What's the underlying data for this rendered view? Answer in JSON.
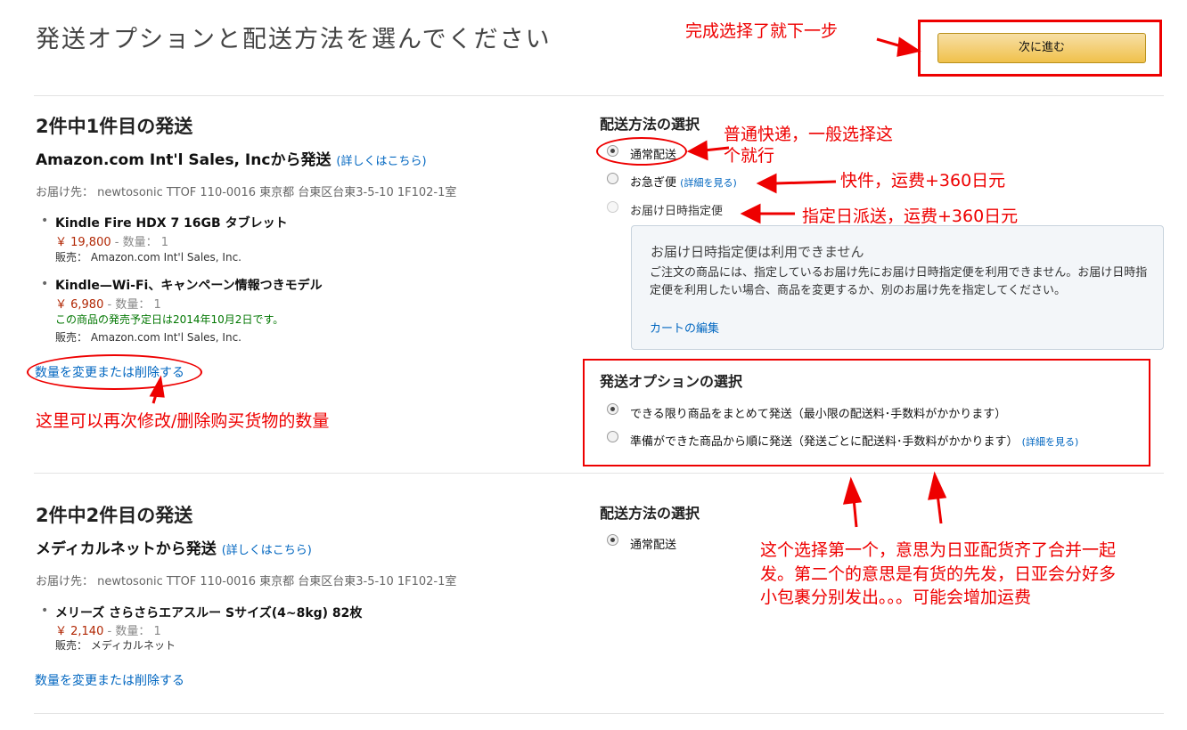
{
  "header": {
    "title": "発送オプションと配送方法を選んでください",
    "next_button": "次に進む"
  },
  "shipment1": {
    "title": "2件中1件目の発送",
    "seller": "Amazon.com Int'l Sales, Incから発送",
    "seller_link": "(詳しくはこちら)",
    "address": "お届け先： newtosonic TTOF 110-0016 東京都 台東区台東3-5-10 1F102-1室",
    "items": [
      {
        "name": "Kindle Fire HDX 7 16GB タブレット",
        "price": "￥ 19,800",
        "qty": "- 数量： 1",
        "release": "",
        "sold_by": "販売： Amazon.com Int'l Sales, Inc."
      },
      {
        "name": "Kindle—Wi-Fi、キャンペーン情報つきモデル",
        "price": "￥ 6,980",
        "qty": "- 数量： 1",
        "release": "この商品の発売予定日は2014年10月2日です。",
        "sold_by": "販売： Amazon.com Int'l Sales, Inc."
      }
    ],
    "change_link": "数量を変更または削除する",
    "delivery_head": "配送方法の選択",
    "delivery_options": [
      {
        "label": "通常配送",
        "link": "",
        "checked": true,
        "disabled": false
      },
      {
        "label": "お急ぎ便",
        "link": "(詳細を見る)",
        "checked": false,
        "disabled": false
      },
      {
        "label": "お届け日時指定便",
        "link": "",
        "checked": false,
        "disabled": true
      }
    ],
    "notice": {
      "title": "お届け日時指定便は利用できません",
      "body": "ご注文の商品には、指定しているお届け先にお届け日時指定便を利用できません。お届け日時指定便を利用したい場合、商品を変更するか、別のお届け先を指定してください。",
      "link": "カートの編集"
    },
    "ship_option_head": "発送オプションの選択",
    "ship_options": [
      {
        "label": "できる限り商品をまとめて発送（最小限の配送料･手数料がかかります）",
        "link": "",
        "checked": true
      },
      {
        "label": "準備ができた商品から順に発送（発送ごとに配送料･手数料がかかります）",
        "link": "(詳細を見る)",
        "checked": false
      }
    ]
  },
  "shipment2": {
    "title": "2件中2件目の発送",
    "seller": "メディカルネットから発送",
    "seller_link": "(詳しくはこちら)",
    "address": "お届け先： newtosonic TTOF 110-0016 東京都 台東区台東3-5-10 1F102-1室",
    "items": [
      {
        "name": "メリーズ さらさらエアスルー Sサイズ(4~8kg) 82枚",
        "price": "￥ 2,140",
        "qty": "- 数量： 1",
        "sold_by": "販売： メディカルネット"
      }
    ],
    "change_link": "数量を変更または削除する",
    "delivery_head": "配送方法の選択",
    "delivery_options": [
      {
        "label": "通常配送",
        "checked": true
      }
    ]
  },
  "annotations": {
    "next_step": "完成选择了就下一步",
    "normal_line1": "普通快递，一般选择这",
    "normal_line2": "个就行",
    "express": "快件，运费+360日元",
    "timed": "指定日派送，运费+360日元",
    "change_qty": "这里可以再次修改/删除购买货物的数量",
    "ship_option_line1": "这个选择第一个，意思为日亚配货齐了合并一起",
    "ship_option_line2": "发。第二个的意思是有货的先发，日亚会分好多",
    "ship_option_line3": "小包裹分别发出。。。可能会增加运费"
  },
  "colors": {
    "annotation_red": "#e00000",
    "price_red": "#b12704",
    "link_blue": "#0066c0",
    "release_green": "#007600",
    "button_yellow": "#f0c14b"
  }
}
